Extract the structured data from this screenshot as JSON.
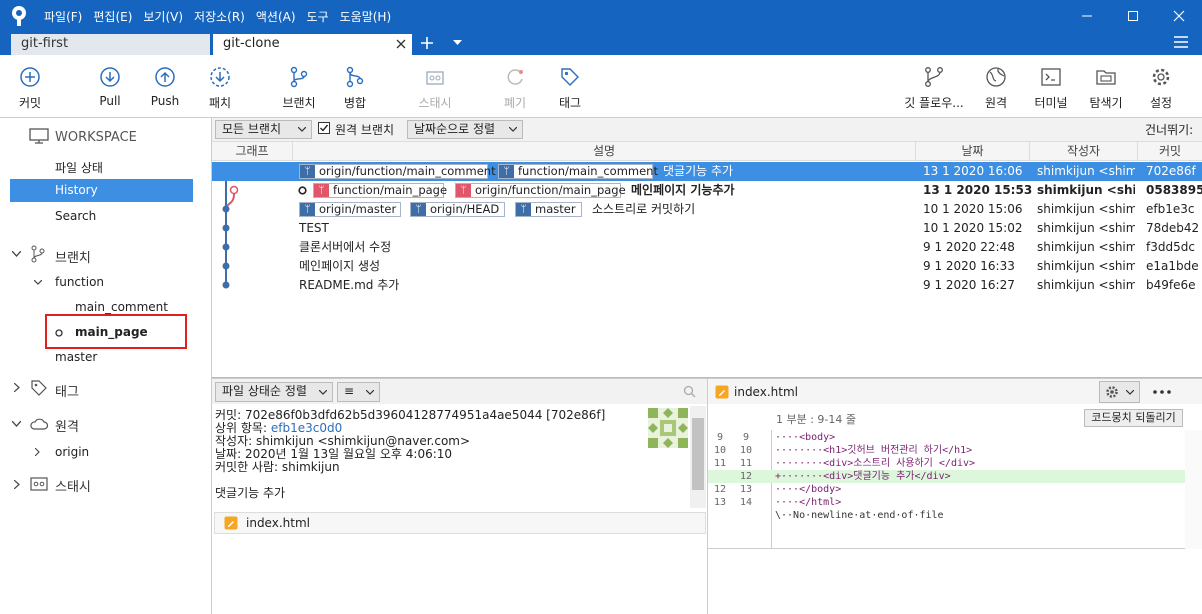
{
  "menu": [
    "파일(F)",
    "편집(E)",
    "보기(V)",
    "저장소(R)",
    "액션(A)",
    "도구",
    "도움말(H)"
  ],
  "tabs": [
    {
      "label": "git-first"
    },
    {
      "label": "git-clone"
    }
  ],
  "toolbar": {
    "commit": "커밋",
    "pull": "Pull",
    "push": "Push",
    "fetch": "패치",
    "branch": "브랜치",
    "merge": "병합",
    "stash": "스태시",
    "discard": "폐기",
    "tag": "태그",
    "gitflow": "깃 플로우...",
    "remote": "원격",
    "terminal": "터미널",
    "explorer": "탐색기",
    "settings": "설정"
  },
  "sidebar": {
    "workspace": "WORKSPACE",
    "file_status": "파일 상태",
    "history": "History",
    "search": "Search",
    "branches": "브랜치",
    "branch_function": "function",
    "branch_main_comment": "main_comment",
    "branch_main_page": "main_page",
    "branch_master": "master",
    "tags": "태그",
    "remotes": "원격",
    "remote_origin": "origin",
    "stashes": "스태시"
  },
  "history_filter": {
    "all_branches": "모든 브랜치",
    "remote_branches": "원격 브랜치",
    "sort_date": "날짜순으로 정렬",
    "jump_to": "건너뛰기:"
  },
  "columns": {
    "graph": "그래프",
    "description": "설명",
    "date": "날짜",
    "author": "작성자",
    "commit": "커밋"
  },
  "commits": [
    {
      "refs": [
        "origin/function/main_comment",
        "function/main_comment"
      ],
      "message": "댓글기능 추가",
      "date": "13 1 2020 16:06",
      "author": "shimkijun <shimki",
      "hash": "702e86f"
    },
    {
      "refs": [
        "function/main_page",
        "origin/function/main_page"
      ],
      "message": "메인페이지 기능추가",
      "date": "13 1 2020 15:53",
      "author": "shimkijun <shimki",
      "hash": "0583895"
    },
    {
      "refs": [
        "origin/master",
        "origin/HEAD",
        "master"
      ],
      "message": "소스트리로 커밋하기",
      "date": "10 1 2020 15:06",
      "author": "shimkijun <shimki",
      "hash": "efb1e3c"
    },
    {
      "refs": [],
      "message": "TEST",
      "date": "10 1 2020 15:02",
      "author": "shimkijun <shimki",
      "hash": "78deb42"
    },
    {
      "refs": [],
      "message": "클론서버에서 수정",
      "date": "9 1 2020 22:48",
      "author": "shimkijun <shimki",
      "hash": "f3dd5dc"
    },
    {
      "refs": [],
      "message": "메인페이지 생성",
      "date": "9 1 2020 16:33",
      "author": "shimkijun <shimki",
      "hash": "e1a1bde"
    },
    {
      "refs": [],
      "message": "README.md 추가",
      "date": "9 1 2020 16:27",
      "author": "shimkijun <shimki",
      "hash": "b49fe6e"
    }
  ],
  "file_filter": {
    "sort": "파일 상태순 정렬",
    "view": "≡"
  },
  "commit_detail": {
    "commit": "커밋: 702e86f0b3dfd62b5d39604128774951a4ae5044 [702e86f]",
    "parent_label": "상위 항목: ",
    "parent_hash": "efb1e3c0d0",
    "author": "작성자: shimkijun <shimkijun@naver.com>",
    "date": "날짜: 2020년 1월 13일 월요일 오후 4:06:10",
    "committer": "커밋한 사람: shimkijun",
    "message": "댓글기능 추가"
  },
  "changed_file": "index.html",
  "diff": {
    "file": "index.html",
    "hunk": "1 부분 : 9-14 줄",
    "revert": "코드뭉치 되돌리기",
    "lines": [
      {
        "a": "9",
        "b": "9",
        "text": "····<body>",
        "type": "ctx"
      },
      {
        "a": "10",
        "b": "10",
        "text": "········<h1>깃허브 버전관리 하기</h1>",
        "type": "ctx"
      },
      {
        "a": "11",
        "b": "11",
        "text": "········<div>소스트리 사용하기 </div>",
        "type": "ctx"
      },
      {
        "a": "",
        "b": "12",
        "text": "+·······<div>댓글기능 추가</div>",
        "type": "add"
      },
      {
        "a": "12",
        "b": "13",
        "text": "····</body>",
        "type": "ctx"
      },
      {
        "a": "13",
        "b": "14",
        "text": "····</html>",
        "type": "ctx"
      },
      {
        "a": "",
        "b": "",
        "text": "\\··No·newline·at·end·of·file",
        "type": "ctx"
      }
    ]
  },
  "colors": {
    "accent": "#1565c0",
    "selection": "#3d8fe3",
    "highlight_box": "#e02020"
  }
}
